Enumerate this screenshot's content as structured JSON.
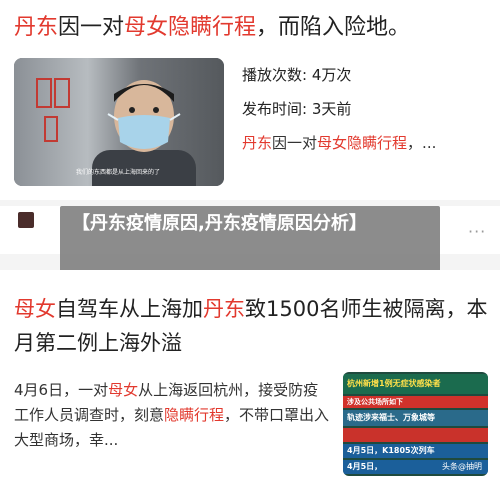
{
  "top_card": {
    "title_hl1": "丹东",
    "title_mid": "因一对",
    "title_hl2": "母女隐瞒行程",
    "title_tail": "，而陷入险地。",
    "video_caption": "我们的东西都是从上海回来的了",
    "views": "播放次数: 4万次",
    "published": "发布时间: 3天前",
    "desc_hl1": "丹东",
    "desc_mid": "因一对",
    "desc_hl2": "母女隐瞒行程",
    "desc_tail": "，..."
  },
  "strip": {
    "more_icon": "···"
  },
  "overlay": {
    "text": "【丹东疫情原因,丹东疫情原因分析】"
  },
  "bottom_card": {
    "title_hl1": "母女",
    "title_mid": "自驾车从上海加",
    "title_hl2": "丹东",
    "title_tail": "致1500名师生被隔离，本月第二例上海外溢",
    "body_a": "4月6日，一对",
    "body_hl1": "母女",
    "body_b": "从上海返回杭州，接受防疫工作人员调查时，刻意",
    "body_hl2": "隐瞒行程",
    "body_c": "，不带口罩出入大型商场，幸...",
    "thumb_head": "杭州新增1例无症状感染者",
    "thumb_red": "涉及公共场所如下",
    "thumb_row1": "轨迹涉来福士、万象城等",
    "thumb_row2": "",
    "thumb_row3": "4月5日，K1805次列车",
    "thumb_row4": "4月5日，",
    "thumb_tag": "头条@抽明"
  },
  "colors": {
    "highlight": "#e2392e",
    "overlay": "#787878"
  }
}
